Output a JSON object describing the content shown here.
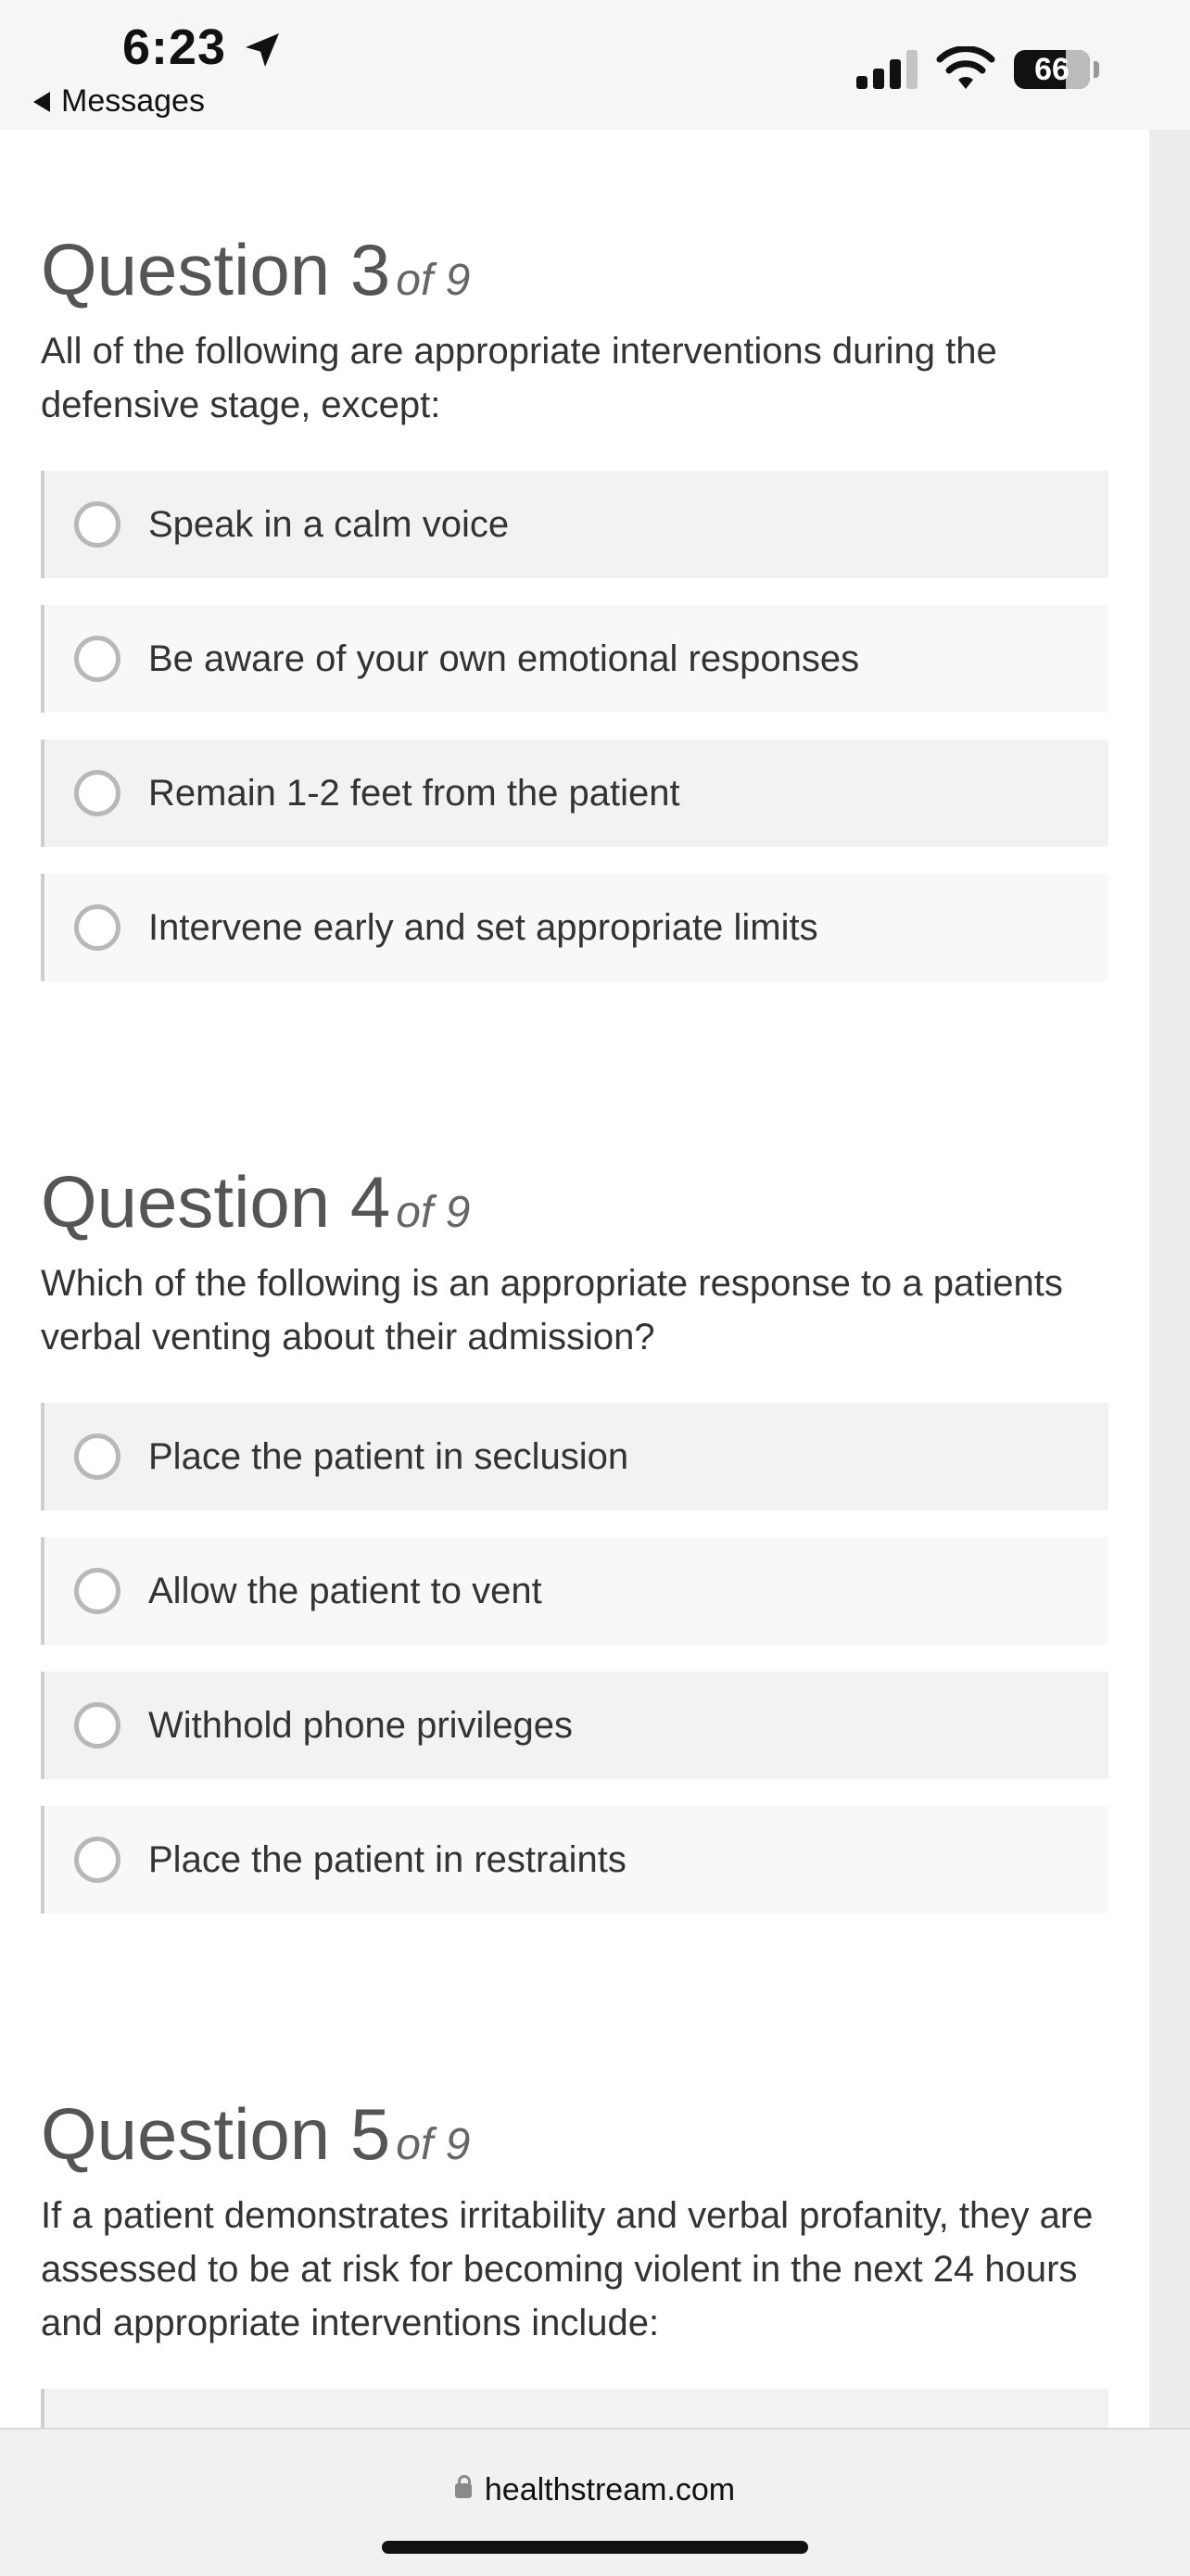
{
  "status_bar": {
    "time": "6:23",
    "back_label": "Messages",
    "battery": "66"
  },
  "questions": [
    {
      "title": "Question 3",
      "of": "of 9",
      "text": "All of the following are appropriate interventions during the defensive stage, except:",
      "options": [
        "Speak in a calm voice",
        "Be aware of your own emotional responses",
        "Remain 1-2 feet from the patient",
        "Intervene early and set appropriate limits"
      ]
    },
    {
      "title": "Question 4",
      "of": "of 9",
      "text": "Which of the following is an appropriate response to a patients verbal venting about their admission?",
      "options": [
        "Place the patient in seclusion",
        "Allow the patient to vent",
        "Withhold phone privileges",
        "Place the patient in restraints"
      ]
    },
    {
      "title": "Question 5",
      "of": "of 9",
      "text": "If a patient demonstrates irritability and verbal profanity, they are assessed to be at risk for becoming violent in the next 24 hours and appropriate interventions include:",
      "options": []
    }
  ],
  "url_bar": {
    "domain": "healthstream.com"
  }
}
